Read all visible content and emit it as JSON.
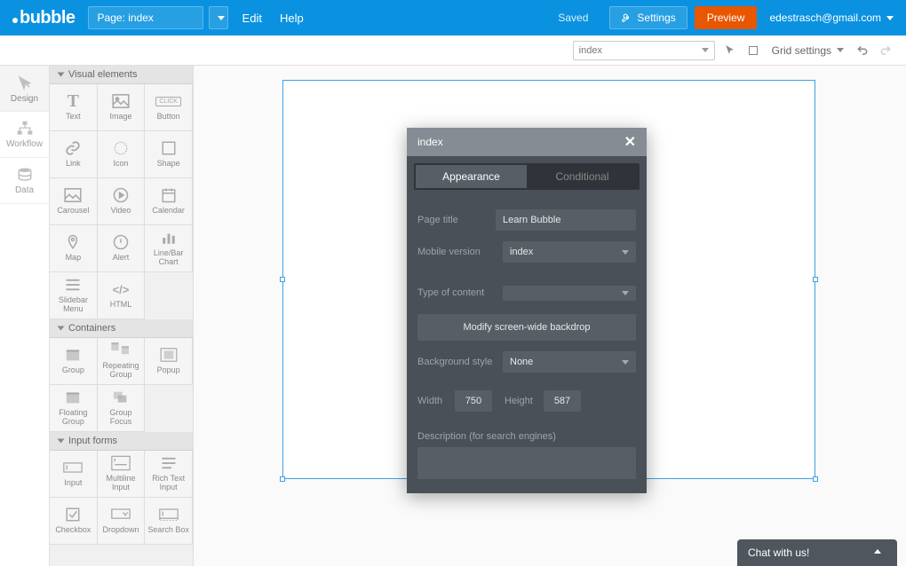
{
  "topbar": {
    "logo_text": "bubble",
    "page_selector": "Page: index",
    "edit": "Edit",
    "help": "Help",
    "saved": "Saved",
    "settings": "Settings",
    "preview": "Preview",
    "user_email": "edestrasch@gmail.com"
  },
  "secbar": {
    "page_dropdown": "index",
    "grid_settings": "Grid settings"
  },
  "leftnav": {
    "items": [
      {
        "label": "Design"
      },
      {
        "label": "Workflow"
      },
      {
        "label": "Data"
      }
    ]
  },
  "palette": {
    "sections": {
      "visual": "Visual elements",
      "containers": "Containers",
      "input_forms": "Input forms"
    },
    "visual_items": [
      {
        "label": "Text"
      },
      {
        "label": "Image"
      },
      {
        "label": "Button"
      },
      {
        "label": "Link"
      },
      {
        "label": "Icon"
      },
      {
        "label": "Shape"
      },
      {
        "label": "Carousel"
      },
      {
        "label": "Video"
      },
      {
        "label": "Calendar"
      },
      {
        "label": "Map"
      },
      {
        "label": "Alert"
      },
      {
        "label": "Line/Bar Chart"
      },
      {
        "label": "Slidebar Menu"
      },
      {
        "label": "HTML"
      }
    ],
    "container_items": [
      {
        "label": "Group"
      },
      {
        "label": "Repeating Group"
      },
      {
        "label": "Popup"
      },
      {
        "label": "Floating Group"
      },
      {
        "label": "Group Focus"
      }
    ],
    "input_items": [
      {
        "label": "Input"
      },
      {
        "label": "Multiline Input"
      },
      {
        "label": "Rich Text Input"
      },
      {
        "label": "Checkbox"
      },
      {
        "label": "Dropdown"
      },
      {
        "label": "Search Box"
      }
    ]
  },
  "inspector": {
    "title": "index",
    "tab_appearance": "Appearance",
    "tab_conditional": "Conditional",
    "page_title_label": "Page title",
    "page_title_value": "Learn Bubble",
    "mobile_label": "Mobile version",
    "mobile_value": "index",
    "type_label": "Type of content",
    "type_value": "",
    "modify_backdrop": "Modify screen-wide backdrop",
    "bg_label": "Background style",
    "bg_value": "None",
    "width_label": "Width",
    "width_value": "750",
    "height_label": "Height",
    "height_value": "587",
    "desc_label": "Description (for search engines)"
  },
  "chat": {
    "label": "Chat with us!"
  }
}
